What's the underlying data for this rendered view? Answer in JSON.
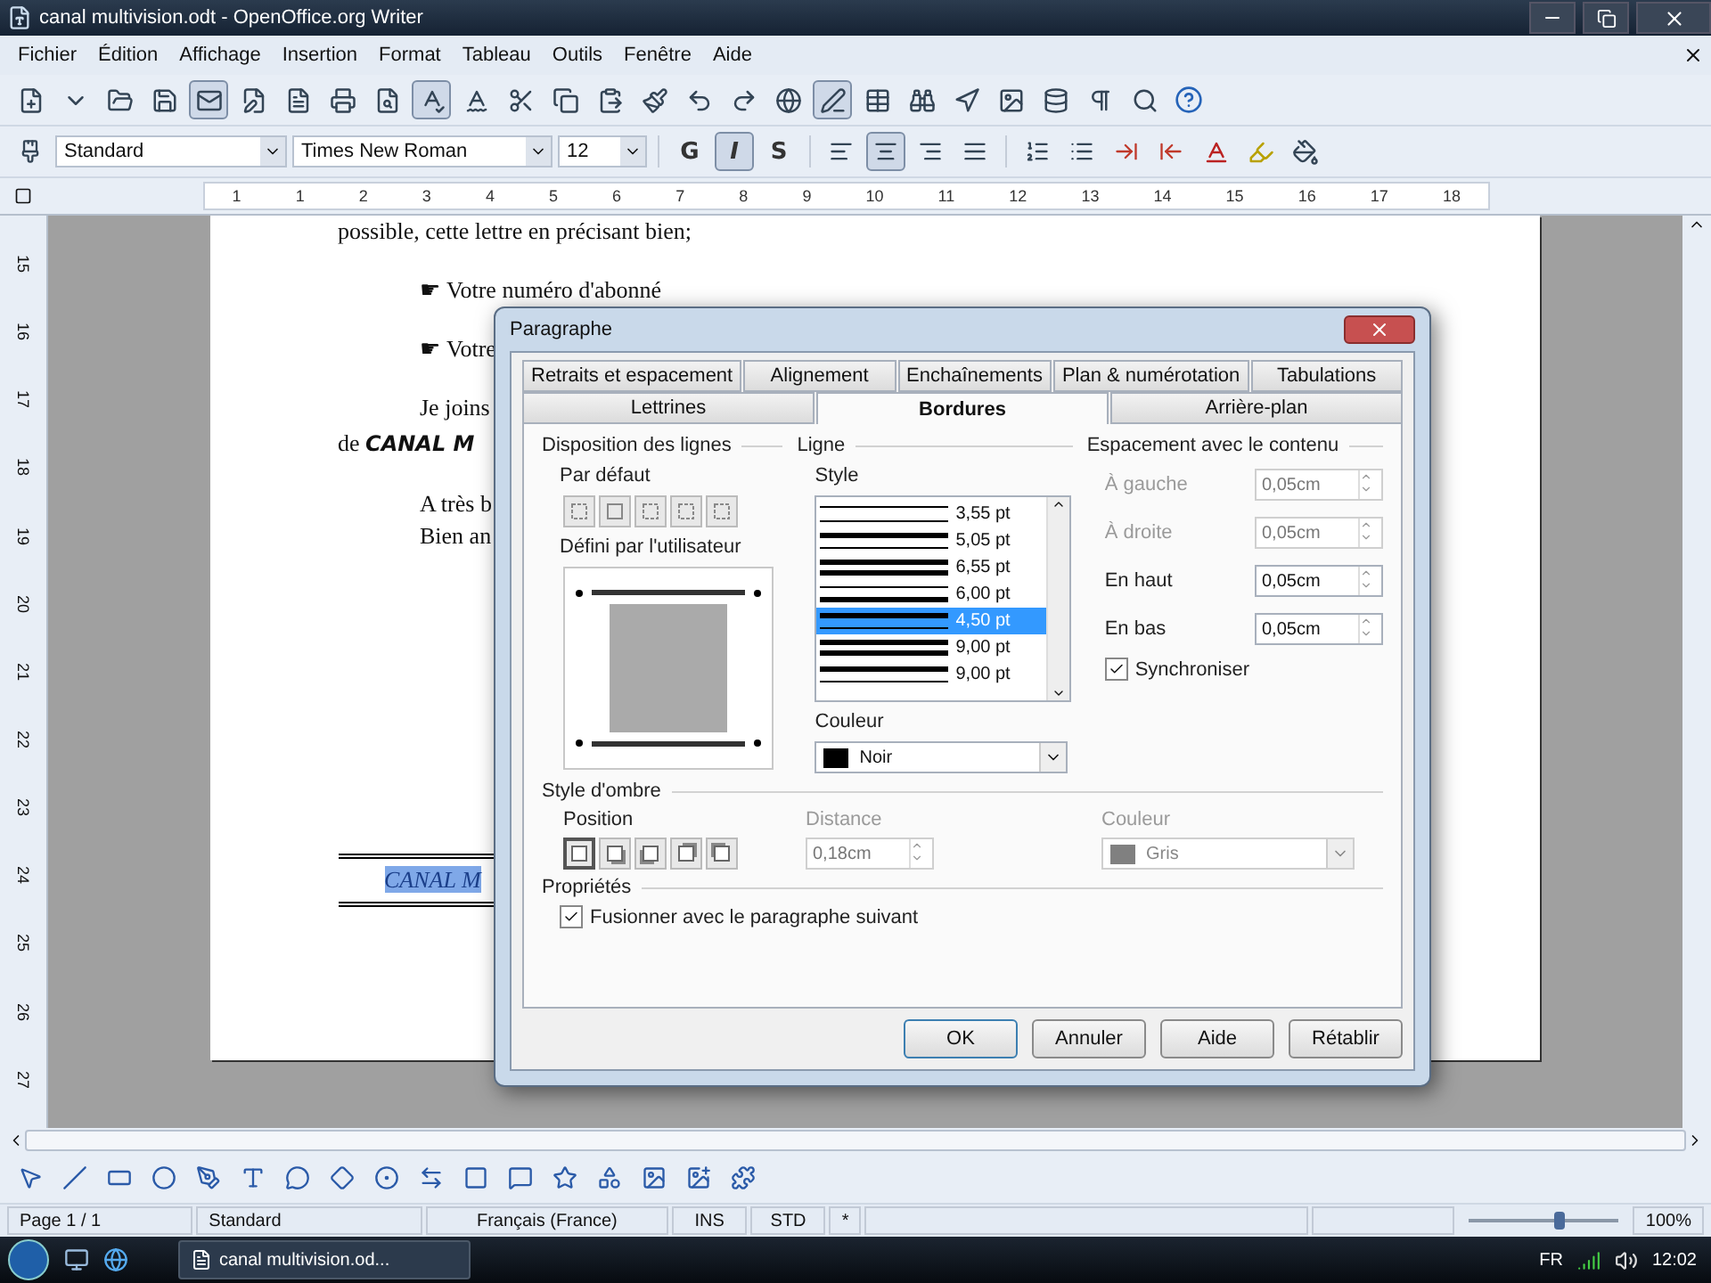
{
  "window": {
    "title": "canal multivision.odt - OpenOffice.org Writer"
  },
  "menu": [
    "Fichier",
    "Édition",
    "Affichage",
    "Insertion",
    "Format",
    "Tableau",
    "Outils",
    "Fenêtre",
    "Aide"
  ],
  "standard_toolbar": [
    {
      "on": false
    },
    {
      "on": false
    },
    {
      "on": false
    },
    {
      "on": false
    },
    {
      "on": true
    },
    {
      "on": false
    },
    {
      "on": false
    },
    {
      "on": false
    },
    {
      "on": false
    },
    {
      "on": true
    },
    {
      "on": false
    },
    {
      "on": false
    },
    {
      "on": false
    },
    {
      "on": false
    },
    {
      "on": false
    },
    {
      "on": false
    },
    {
      "on": false
    },
    {
      "on": false
    },
    {
      "on": true
    },
    {
      "on": false
    },
    {
      "on": false
    },
    {
      "on": false
    },
    {
      "on": false
    },
    {
      "on": false
    },
    {
      "on": false
    },
    {
      "on": false
    }
  ],
  "format_toolbar": {
    "style": "Standard",
    "font": "Times New Roman",
    "size": "12",
    "text_buttons": [
      {
        "label": "G",
        "on": false
      },
      {
        "label": "I",
        "on": true
      },
      {
        "label": "S",
        "on": false
      }
    ],
    "align_buttons": [
      {
        "on": false
      },
      {
        "on": true
      },
      {
        "on": false
      },
      {
        "on": false
      }
    ]
  },
  "ruler": {
    "labels": [
      "1",
      "1",
      "2",
      "3",
      "4",
      "5",
      "6",
      "7",
      "8",
      "9",
      "10",
      "11",
      "12",
      "13",
      "14",
      "15",
      "16",
      "17",
      "18"
    ]
  },
  "vertical_ruler": {
    "labels": [
      "15",
      "16",
      "17",
      "18",
      "19",
      "20",
      "21",
      "22",
      "23",
      "24",
      "25",
      "26",
      "27"
    ]
  },
  "document": {
    "lines": [
      {
        "kind": "plain",
        "text": "possible, cette lettre en précisant bien;"
      },
      {
        "kind": "bullet",
        "mark": "☛",
        "text": "Votre numéro d'abonné"
      },
      {
        "kind": "bullet",
        "mark": "☛",
        "text": "Votre"
      },
      {
        "kind": "indent",
        "text": "Je joins"
      },
      {
        "kind": "plain",
        "text": "de **CANAL M**"
      },
      {
        "kind": "indent",
        "text": "A très b"
      },
      {
        "kind": "indent-tight",
        "text": "Bien an"
      }
    ],
    "bordered_text": "CANAL M"
  },
  "dialog": {
    "title": "Paragraphe",
    "tabs_row_1": [
      {
        "label": "Retraits et espacement",
        "selected": false
      },
      {
        "label": "Alignement",
        "selected": false
      },
      {
        "label": "Enchaînements",
        "selected": false
      },
      {
        "label": "Plan & numérotation",
        "selected": false
      },
      {
        "label": "Tabulations",
        "selected": false
      }
    ],
    "tabs_row_2": [
      {
        "label": "Lettrines",
        "selected": false
      },
      {
        "label": "Bordures",
        "selected": true
      },
      {
        "label": "Arrière-plan",
        "selected": false
      }
    ],
    "line_arrangement": {
      "title": "Disposition des lignes",
      "default_label": "Par défaut",
      "presets": [
        {
          "selected": false
        },
        {
          "selected": false
        },
        {
          "selected": false
        },
        {
          "selected": false
        },
        {
          "selected": false
        }
      ],
      "user_label": "Défini par l'utilisateur"
    },
    "line": {
      "title": "Ligne",
      "style_label": "Style",
      "styles": [
        {
          "label": "3,55 pt",
          "kind": "thin-thin",
          "selected": false
        },
        {
          "label": "5,05 pt",
          "kind": "thick-thin",
          "selected": false
        },
        {
          "label": "6,55 pt",
          "kind": "thick-thick",
          "selected": false
        },
        {
          "label": "6,00 pt",
          "kind": "thin-thick",
          "selected": false
        },
        {
          "label": "4,50 pt",
          "kind": "thick-thin",
          "selected": true
        },
        {
          "label": "9,00 pt",
          "kind": "thick-thick",
          "selected": false
        },
        {
          "label": "9,00 pt",
          "kind": "thick-thin",
          "selected": false
        }
      ],
      "color_label": "Couleur",
      "color": {
        "label": "Noir",
        "color": "#000000"
      }
    },
    "spacing": {
      "title": "Espacement avec le contenu",
      "fields": [
        {
          "label": "À gauche",
          "value": "0,05cm",
          "disabled": true
        },
        {
          "label": "À droite",
          "value": "0,05cm",
          "disabled": true
        },
        {
          "label": "En haut",
          "value": "0,05cm",
          "disabled": false
        },
        {
          "label": "En bas",
          "value": "0,05cm",
          "disabled": false
        }
      ],
      "synchronize": {
        "label": "Synchroniser",
        "checked": true
      }
    },
    "shadow": {
      "title": "Style d'ombre",
      "position_label": "Position",
      "positions": [
        {
          "selected": true
        },
        {
          "selected": false
        },
        {
          "selected": false
        },
        {
          "selected": false
        },
        {
          "selected": false
        }
      ],
      "distance_label": "Distance",
      "distance": "0,18cm",
      "color_label": "Couleur",
      "color": {
        "label": "Gris",
        "color": "#808080"
      },
      "disabled": true
    },
    "properties": {
      "title": "Propriétés",
      "merge": {
        "label": "Fusionner avec le paragraphe suivant",
        "checked": true
      }
    },
    "buttons": [
      "OK",
      "Annuler",
      "Aide",
      "Rétablir"
    ]
  },
  "status_bar": {
    "page": "Page 1 / 1",
    "style": "Standard",
    "language": "Français (France)",
    "insert": "INS",
    "selection": "STD",
    "modified": "*",
    "zoom": {
      "level": 0.6,
      "reading": "100%"
    }
  },
  "taskbar": {
    "task": "canal multivision.od...",
    "language": "FR",
    "clock": "12:02"
  }
}
